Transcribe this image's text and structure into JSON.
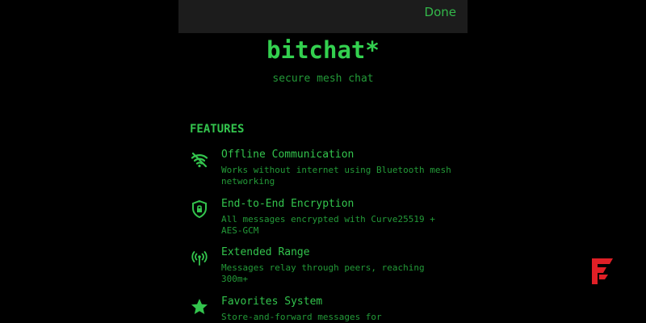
{
  "topbar": {
    "done_label": "Done"
  },
  "header": {
    "title": "bitchat*",
    "subtitle": "secure mesh chat"
  },
  "features": {
    "heading": "FEATURES",
    "items": [
      {
        "icon": "wifi-off-icon",
        "title": "Offline Communication",
        "description": "Works without internet using Bluetooth mesh networking"
      },
      {
        "icon": "shield-lock-icon",
        "title": "End-to-End Encryption",
        "description": "All messages encrypted with Curve25519 + AES-GCM"
      },
      {
        "icon": "antenna-icon",
        "title": "Extended Range",
        "description": "Messages relay through peers, reaching 300m+"
      },
      {
        "icon": "star-icon",
        "title": "Favorites System",
        "description": "Store-and-forward messages for"
      }
    ]
  },
  "colors": {
    "background": "#000000",
    "topbar": "#1c1c1c",
    "accent": "#33c44d",
    "accent_dim": "#239a38",
    "logo_red": "#e01f26"
  }
}
